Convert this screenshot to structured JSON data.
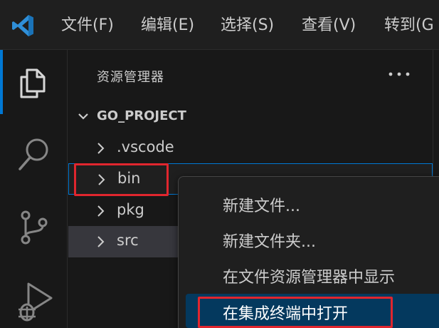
{
  "menubar": {
    "items": [
      "文件(F)",
      "编辑(E)",
      "选择(S)",
      "查看(V)",
      "转到(G"
    ]
  },
  "activity_bar": {
    "items": [
      "explorer-icon",
      "search-icon",
      "source-control-icon",
      "run-debug-icon"
    ],
    "active": "explorer-icon",
    "accent_color": "#0078d4"
  },
  "sidebar": {
    "title": "资源管理器",
    "more_icon": "ellipsis-icon",
    "section": "GO_PROJECT",
    "tree": [
      {
        "label": ".vscode",
        "type": "folder",
        "expanded": false
      },
      {
        "label": "bin",
        "type": "folder",
        "expanded": false,
        "selected": true
      },
      {
        "label": "pkg",
        "type": "folder",
        "expanded": false
      },
      {
        "label": "src",
        "type": "folder",
        "expanded": false,
        "hovered": true
      }
    ]
  },
  "context_menu": {
    "items": [
      {
        "label": "新建文件..."
      },
      {
        "label": "新建文件夹..."
      },
      {
        "label": "在文件资源管理器中显示"
      },
      {
        "label": "在集成终端中打开",
        "active": true
      }
    ]
  },
  "annotation_color": "#e0262e"
}
